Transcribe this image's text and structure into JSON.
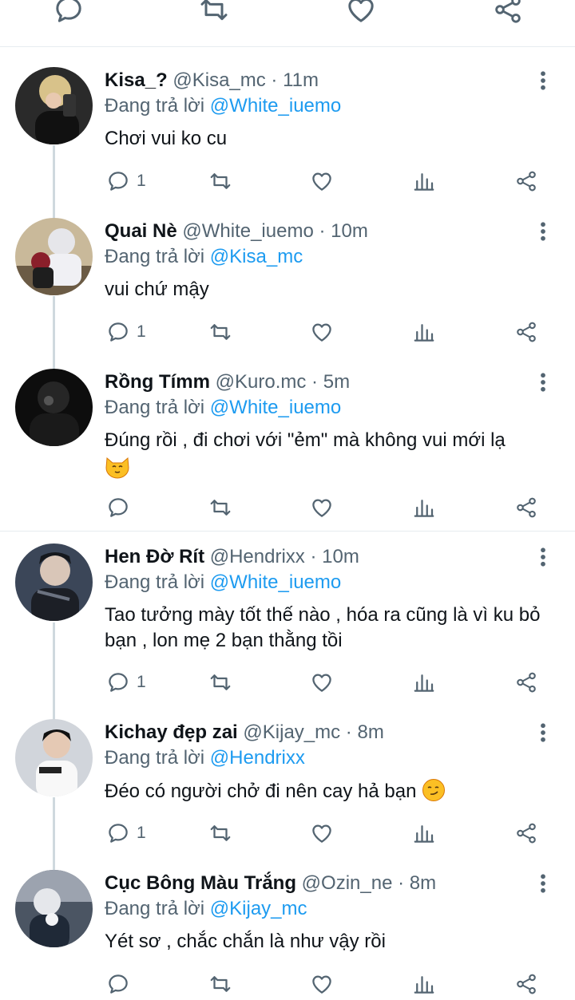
{
  "reply_prefix": "Đang trả lời",
  "tweets": [
    {
      "name": "Kisa_?",
      "handle": "@Kisa_mc",
      "time": "11m",
      "reply_to": "@White_iuemo",
      "text": "Chơi vui ko cu",
      "reply_count": "1"
    },
    {
      "name": "Quai Nè",
      "handle": "@White_iuemo",
      "time": "10m",
      "reply_to": "@Kisa_mc",
      "text": "vui chứ mậy",
      "reply_count": "1"
    },
    {
      "name": "Rồng Tímm",
      "handle": "@Kuro.mc",
      "time": "5m",
      "reply_to": "@White_iuemo",
      "text": "Đúng rồi , đi chơi với \"ẻm\" mà không vui mới lạ",
      "emoji": "cat-face-emoji",
      "reply_count": ""
    },
    {
      "name": "Hen Đờ Rít",
      "handle": "@Hendrixx",
      "time": "10m",
      "reply_to": "@White_iuemo",
      "text": "Tao tưởng mày tốt thế nào , hóa ra cũng là vì ku bỏ bạn , lon mẹ 2 bạn thằng tồi",
      "reply_count": "1"
    },
    {
      "name": "Kichay đẹp zai",
      "handle": "@Kijay_mc",
      "time": "8m",
      "reply_to": "@Hendrixx",
      "text": "Đéo có người chở đi nên cay hả bạn",
      "emoji": "smirking-face-emoji",
      "reply_count": "1"
    },
    {
      "name": "Cục Bông Màu Trắng",
      "handle": "@Ozin_ne",
      "time": "8m",
      "reply_to": "@Kijay_mc",
      "text": "Yét sơ , chắc chắn là như vậy rồi",
      "reply_count": ""
    }
  ],
  "colors": {
    "mention": "#1d9bf0",
    "secondary": "#536471",
    "divider": "#e6ecf0",
    "thread": "#cfd9de"
  }
}
